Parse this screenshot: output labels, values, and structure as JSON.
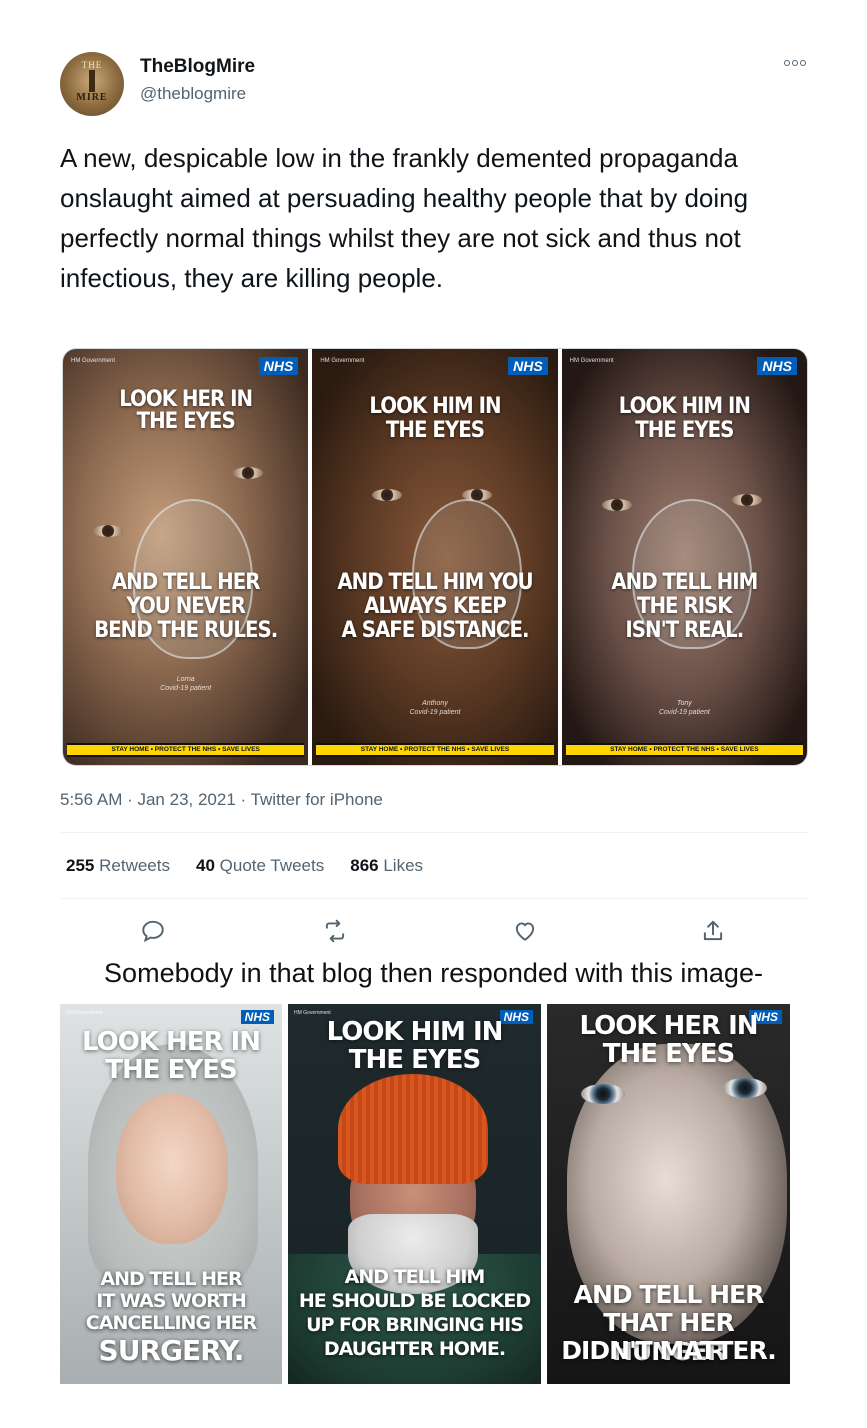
{
  "tweet": {
    "author": {
      "name": "TheBlogMire",
      "handle": "@theblogmire",
      "avatar_top": "THE",
      "avatar_bottom": "MIRE"
    },
    "text": "A new, despicable low in the frankly demented propaganda onslaught aimed at persuading healthy people that by doing perfectly normal things whilst they are not sick and thus not infectious, they are killing people.",
    "posters": [
      {
        "nhs": "NHS",
        "crest": "HM Government",
        "headline": "LOOK HER IN\nTHE EYES",
        "subline": "AND TELL HER\nYOU NEVER\nBEND THE RULES.",
        "caption": "Lorna\nCovid-19 patient",
        "tape": "STAY HOME • PROTECT THE NHS • SAVE LIVES"
      },
      {
        "nhs": "NHS",
        "crest": "HM Government",
        "headline": "LOOK HIM IN\nTHE EYES",
        "subline": "AND TELL HIM YOU\nALWAYS KEEP\nA SAFE DISTANCE.",
        "caption": "Anthony\nCovid-19 patient",
        "tape": "STAY HOME • PROTECT THE NHS • SAVE LIVES"
      },
      {
        "nhs": "NHS",
        "crest": "HM Government",
        "headline": "LOOK HIM IN\nTHE EYES",
        "subline": "AND TELL HIM\nTHE RISK\nISN'T REAL.",
        "caption": "Tony\nCovid-19 patient",
        "tape": "STAY HOME • PROTECT THE NHS • SAVE LIVES"
      }
    ],
    "timestamp": "5:56 AM · Jan 23, 2021 · Twitter for iPhone",
    "stats": {
      "retweets_count": "255",
      "retweets_label": "Retweets",
      "quotes_count": "40",
      "quotes_label": "Quote Tweets",
      "likes_count": "866",
      "likes_label": "Likes"
    },
    "actions": [
      "reply-icon",
      "retweet-icon",
      "like-icon",
      "share-icon"
    ]
  },
  "caption": "Somebody in that blog then responded with this image-",
  "response_posters": [
    {
      "nhs": "NHS",
      "crest": "HM Government",
      "headline": "LOOK HER IN\nTHE EYES",
      "lines": [
        "AND TELL HER",
        "IT WAS WORTH",
        "CANCELLING HER",
        "SURGERY."
      ]
    },
    {
      "nhs": "NHS",
      "crest": "HM Government",
      "headline": "LOOK HIM IN\nTHE EYES",
      "lines": [
        "AND TELL HIM",
        "HE SHOULD BE LOCKED",
        "UP FOR BRINGING HIS",
        "DAUGHTER HOME."
      ]
    },
    {
      "nhs": "NHS",
      "headline": "LOOK HER IN\nTHE EYES",
      "lines": [
        "AND TELL HER",
        "THAT HER HUNGER",
        "DIDN'T MATTER."
      ]
    }
  ],
  "colors": {
    "nhs_blue": "#005eb8",
    "tape_yellow": "#ffd400",
    "secondary_text": "#536471"
  }
}
